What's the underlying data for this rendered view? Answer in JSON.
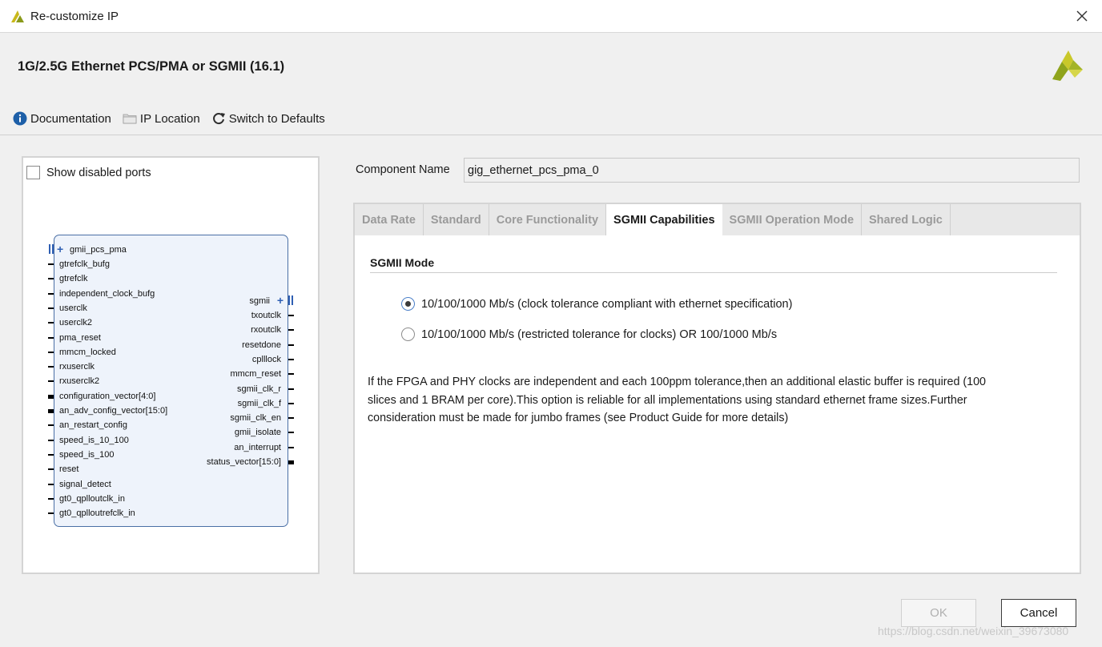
{
  "window": {
    "title": "Re-customize IP"
  },
  "header": {
    "ip_title": "1G/2.5G Ethernet PCS/PMA or SGMII (16.1)"
  },
  "toolbar": {
    "documentation": "Documentation",
    "ip_location": "IP Location",
    "switch_defaults": "Switch to Defaults"
  },
  "left_panel": {
    "show_disabled_ports": "Show disabled ports",
    "symbol": {
      "interface_left": "gmii_pcs_pma",
      "left_ports": [
        "gtrefclk_bufg",
        "gtrefclk",
        "independent_clock_bufg",
        "userclk",
        "userclk2",
        "pma_reset",
        "mmcm_locked",
        "rxuserclk",
        "rxuserclk2",
        "configuration_vector[4:0]",
        "an_adv_config_vector[15:0]",
        "an_restart_config",
        "speed_is_10_100",
        "speed_is_100",
        "reset",
        "signal_detect",
        "gt0_qplloutclk_in",
        "gt0_qplloutrefclk_in"
      ],
      "interface_right": "sgmii",
      "right_ports": [
        "txoutclk",
        "rxoutclk",
        "resetdone",
        "cplllock",
        "mmcm_reset",
        "sgmii_clk_r",
        "sgmii_clk_f",
        "sgmii_clk_en",
        "gmii_isolate",
        "an_interrupt",
        "status_vector[15:0]"
      ]
    }
  },
  "component": {
    "label": "Component Name",
    "value": "gig_ethernet_pcs_pma_0"
  },
  "tabs": [
    {
      "label": "Data Rate"
    },
    {
      "label": "Standard"
    },
    {
      "label": "Core Functionality"
    },
    {
      "label": "SGMII Capabilities"
    },
    {
      "label": "SGMII Operation Mode"
    },
    {
      "label": "Shared Logic"
    }
  ],
  "sgmii": {
    "section_title": "SGMII Mode",
    "option1": "10/100/1000 Mb/s (clock tolerance compliant with ethernet specification)",
    "option2": "10/100/1000 Mb/s (restricted tolerance for clocks) OR 100/1000 Mb/s",
    "description": "If the FPGA and PHY clocks are independent and each 100ppm tolerance,then an additional elastic buffer is required (100 slices and 1 BRAM per core).This option is reliable for all implementations using standard ethernet frame sizes.Further consideration must be made for jumbo frames (see Product Guide for more details)"
  },
  "buttons": {
    "ok": "OK",
    "cancel": "Cancel"
  },
  "watermark": "https://blog.csdn.net/weixin_39673080",
  "colors": {
    "accent": "#4a7fc8",
    "symbol_border": "#4a6fa5",
    "symbol_fill": "#eef3fb",
    "xilinx_logo": "#c0c020"
  }
}
